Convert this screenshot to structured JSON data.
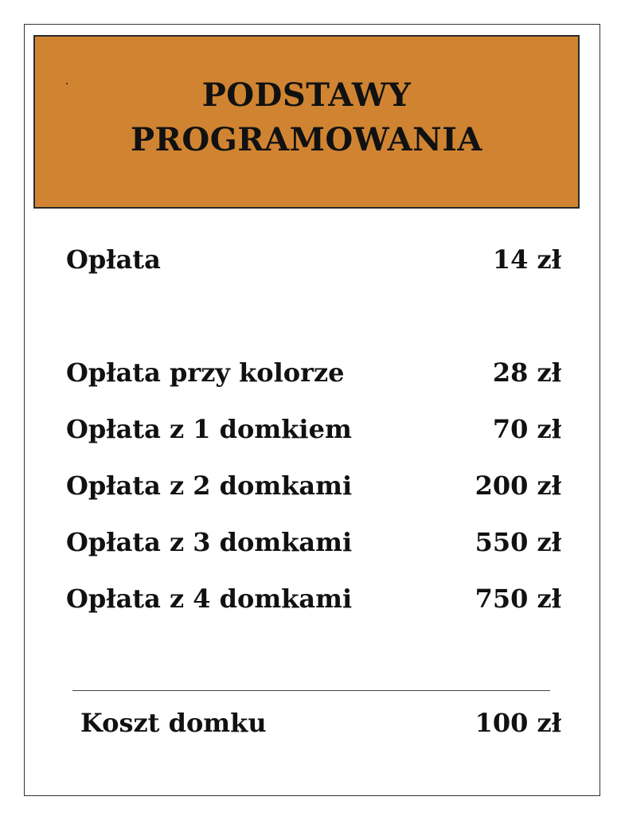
{
  "header": {
    "title_line1": "PODSTAWY",
    "title_line2": "PROGRAMOWANIA",
    "color": "#D08432"
  },
  "rent": {
    "base": {
      "label": "Opłata",
      "value": "14 zł"
    },
    "color_set": {
      "label": "Opłata przy kolorze",
      "value": "28 zł"
    },
    "houses": [
      {
        "label": "Opłata z 1 domkiem",
        "value": "70 zł"
      },
      {
        "label": "Opłata z 2 domkami",
        "value": "200 zł"
      },
      {
        "label": "Opłata z 3 domkami",
        "value": "550 zł"
      },
      {
        "label": "Opłata z 4 domkami",
        "value": "750 zł"
      }
    ]
  },
  "house_cost": {
    "label": "Koszt domku",
    "value": "100 zł"
  }
}
